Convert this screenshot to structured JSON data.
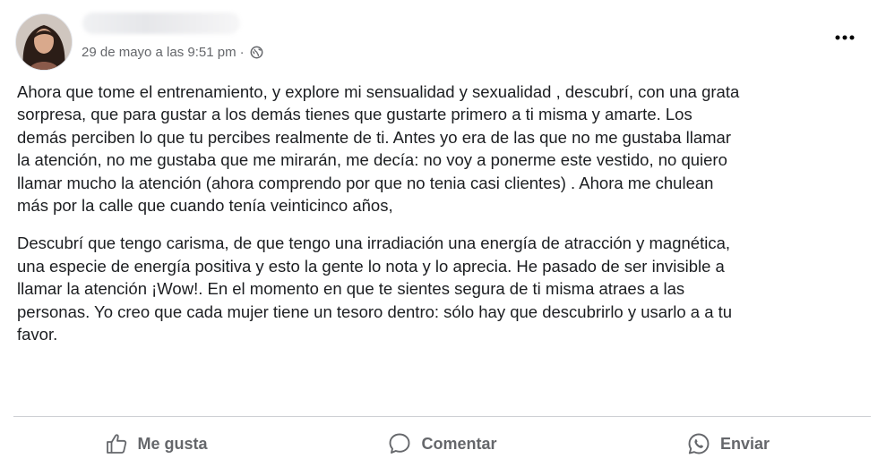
{
  "post": {
    "timestamp": "29 de mayo a las 9:51 pm",
    "separator": "·",
    "privacy_icon": "globe-icon",
    "more_icon": "more-options-icon",
    "paragraphs": [
      "Ahora que tome el entrenamiento, y explore mi sensualidad y sexualidad , descubrí, con una grata\nsorpresa, que para gustar a los demás tienes que gustarte primero a ti misma y amarte. Los\ndemás perciben lo que tu percibes realmente de ti. Antes yo era de las que no me gustaba llamar\nla atención, no me gustaba que me mirarán, me decía: no voy a ponerme este vestido, no quiero\nllamar mucho la atención (ahora comprendo por que no tenia casi clientes) . Ahora me chulean\nmás por la calle que cuando tenía veinticinco años,",
      "Descubrí que tengo carisma, de que tengo una irradiación una energía de atracción y magnética,\nuna especie de energía positiva y esto la gente lo nota y lo aprecia. He pasado de ser invisible a\nllamar la atención ¡Wow!. En el momento en que te sientes segura de ti misma atraes a las\npersonas. Yo creo que cada mujer tiene un tesoro dentro: sólo hay que descubrirlo y usarlo a a tu\nfavor."
    ]
  },
  "actions": {
    "like": {
      "label": "Me gusta",
      "icon": "thumbs-up-icon"
    },
    "comment": {
      "label": "Comentar",
      "icon": "comment-icon"
    },
    "send": {
      "label": "Enviar",
      "icon": "whatsapp-icon"
    }
  },
  "colors": {
    "secondary_text": "#65676b",
    "primary_text": "#1c1e21",
    "divider": "#ced0d4"
  }
}
